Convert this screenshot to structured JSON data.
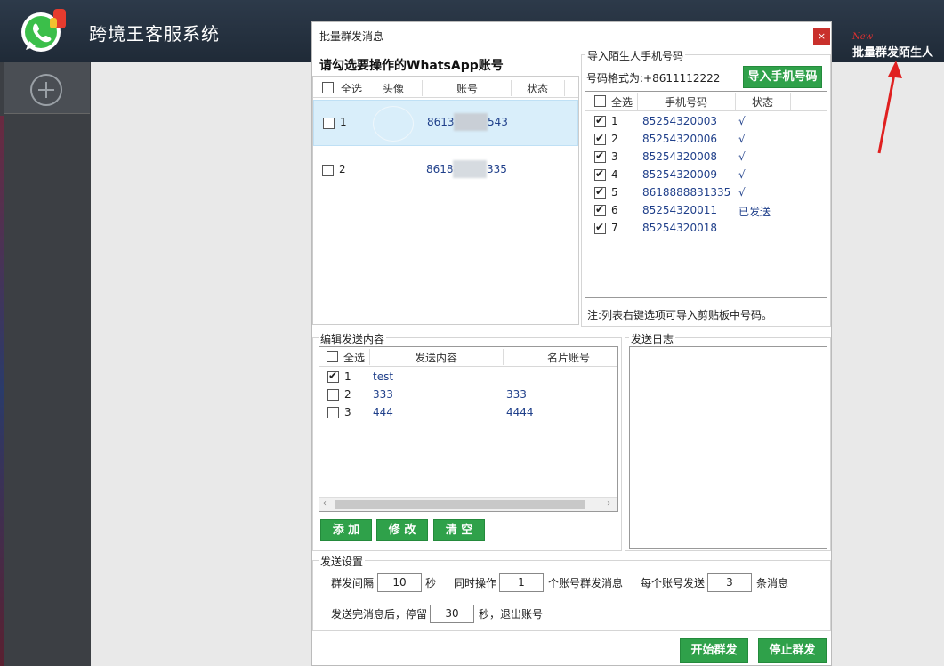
{
  "app": {
    "title": "跨境王客服系统",
    "new_tag": "New",
    "top_right_label": "批量群发陌生人"
  },
  "dialog": {
    "title": "批量群发消息",
    "close_label": "×",
    "accounts": {
      "heading": "请勾选要操作的WhatsApp账号",
      "columns": [
        "全选",
        "头像",
        "账号",
        "状态"
      ],
      "rows": [
        {
          "index": "1",
          "account": "86137",
          "account_tail": "543",
          "status": ""
        },
        {
          "index": "2",
          "account": "86188",
          "account_tail": "335",
          "status": ""
        }
      ]
    },
    "import": {
      "legend": "导入陌生人手机号码",
      "format_label": "号码格式为:+8611112222",
      "import_button": "导入手机号码",
      "columns": [
        "全选",
        "手机号码",
        "状态"
      ],
      "rows": [
        {
          "index": "1",
          "phone": "85254320003",
          "status": "√",
          "checked": true
        },
        {
          "index": "2",
          "phone": "85254320006",
          "status": "√",
          "checked": true
        },
        {
          "index": "3",
          "phone": "85254320008",
          "status": "√",
          "checked": true
        },
        {
          "index": "4",
          "phone": "85254320009",
          "status": "√",
          "checked": true
        },
        {
          "index": "5",
          "phone": "8618888831335",
          "status": "√",
          "checked": true
        },
        {
          "index": "6",
          "phone": "85254320011",
          "status": "已发送",
          "checked": true
        },
        {
          "index": "7",
          "phone": "85254320018",
          "status": "",
          "checked": true
        }
      ],
      "note": "注:列表右键选项可导入剪贴板中号码。"
    },
    "content": {
      "legend": "编辑发送内容",
      "columns": [
        "全选",
        "发送内容",
        "名片账号"
      ],
      "rows": [
        {
          "index": "1",
          "text": "test",
          "card": "",
          "checked": true
        },
        {
          "index": "2",
          "text": "333",
          "card": "333",
          "checked": false
        },
        {
          "index": "3",
          "text": "444",
          "card": "4444",
          "checked": false
        }
      ],
      "buttons": {
        "add": "添 加",
        "edit": "修 改",
        "clear": "清 空"
      }
    },
    "log": {
      "legend": "发送日志"
    },
    "settings": {
      "legend": "发送设置",
      "interval_label": "群发间隔",
      "interval_value": "10",
      "interval_unit": "秒",
      "concurrent_label": "同时操作",
      "concurrent_value": "1",
      "concurrent_unit": "个账号群发消息",
      "per_account_label": "每个账号发送",
      "per_account_value": "3",
      "per_account_unit": "条消息",
      "pause_label": "发送完消息后，停留",
      "pause_value": "30",
      "pause_unit": "秒，退出账号"
    },
    "actions": {
      "start": "开始群发",
      "stop": "停止群发"
    }
  }
}
